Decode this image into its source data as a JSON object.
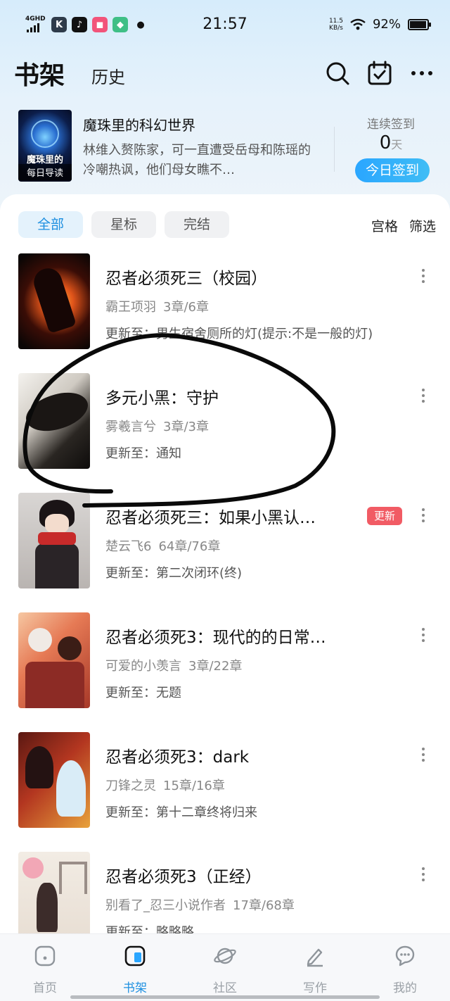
{
  "status_bar": {
    "network": "4GHD",
    "time": "21:57",
    "speed_value": "11.5",
    "speed_unit": "KB/s",
    "battery": "92%"
  },
  "header": {
    "tab_shelf": "书架",
    "tab_history": "历史",
    "icons": [
      "search-icon",
      "calendar-check-icon",
      "more-icon"
    ]
  },
  "featured": {
    "cover_title": "魔珠里的",
    "cover_caption": "每日导读",
    "title": "魔珠里的科幻世界",
    "description": "林维入赘陈家，可一直遭受岳母和陈瑶的冷嘲热讽，他们母女瞧不…",
    "checkin_label": "连续签到",
    "checkin_days": "0",
    "checkin_unit": "天",
    "checkin_button": "今日签到"
  },
  "filters": {
    "chips": [
      "全部",
      "星标",
      "完结"
    ],
    "active": "全部",
    "grid": "宫格",
    "filter": "筛选"
  },
  "books": [
    {
      "title": "忍者必须死三（校园）",
      "author": "霸王项羽",
      "chapters": "3章/6章",
      "update": "更新至：男生宿舍厕所的灯(提示:不是一般的灯)",
      "badge": ""
    },
    {
      "title": "多元小黑：守护",
      "author": "雾羲言兮",
      "chapters": "3章/3章",
      "update": "更新至：通知",
      "badge": ""
    },
    {
      "title": "忍者必须死三：如果小黑认…",
      "author": "楚云飞6",
      "chapters": "64章/76章",
      "update": "更新至：第二次闭环(终)",
      "badge": "更新"
    },
    {
      "title": "忍者必须死3：现代的的日常…",
      "author": "可爱的小羡言",
      "chapters": "3章/22章",
      "update": "更新至：无题",
      "badge": ""
    },
    {
      "title": "忍者必须死3：dark",
      "author": "刀锋之灵",
      "chapters": "15章/16章",
      "update": "更新至：第十二章终将归来",
      "badge": ""
    },
    {
      "title": "忍者必须死3（正经）",
      "author": "别看了_忍三小说作者",
      "chapters": "17章/68章",
      "update": "更新至：略略略",
      "badge": ""
    }
  ],
  "bottom_nav": [
    {
      "label": "首页",
      "icon": "home-icon"
    },
    {
      "label": "书架",
      "icon": "bookshelf-icon"
    },
    {
      "label": "社区",
      "icon": "planet-icon"
    },
    {
      "label": "写作",
      "icon": "pen-icon"
    },
    {
      "label": "我的",
      "icon": "chat-bubble-icon"
    }
  ],
  "colors": {
    "accent": "#1d8fe0",
    "badge": "#f15b64",
    "checkin": "#2aa6ff"
  }
}
